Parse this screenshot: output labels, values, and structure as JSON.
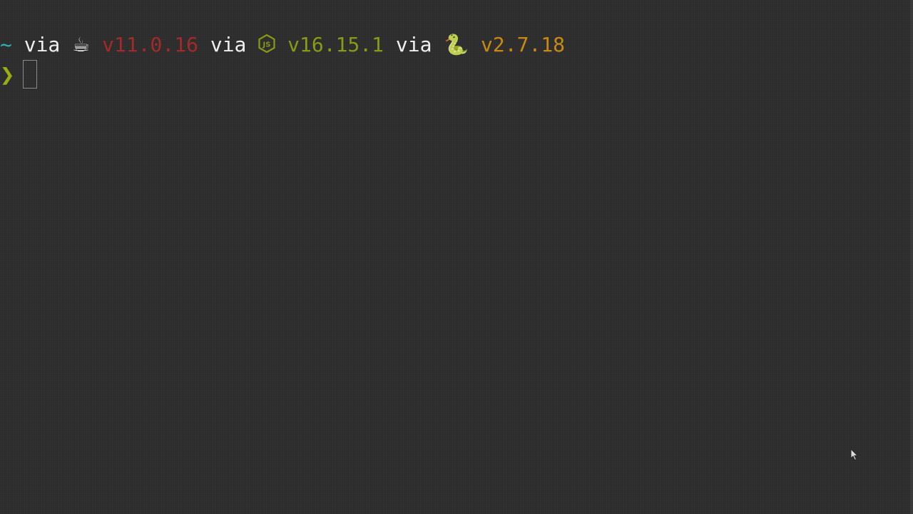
{
  "prompt": {
    "directory": {
      "text": "~",
      "color": "#2fb4b4"
    },
    "segments": [
      {
        "via": "via",
        "icon": "coffee-icon",
        "icon_glyph": "☕",
        "version": "v11.0.16",
        "color": "#a32a2a"
      },
      {
        "via": "via",
        "icon": "nodejs-icon",
        "version": "v16.15.1",
        "color": "#8a9a16"
      },
      {
        "via": "via",
        "icon": "python-snake-icon",
        "icon_glyph": "🐍",
        "version": "v2.7.18",
        "color": "#c98a12"
      }
    ],
    "prompt_symbol": {
      "text": "❯",
      "color": "#9aad17"
    }
  },
  "colors": {
    "background": "#2c2c2c",
    "foreground": "#f0f0f0"
  }
}
